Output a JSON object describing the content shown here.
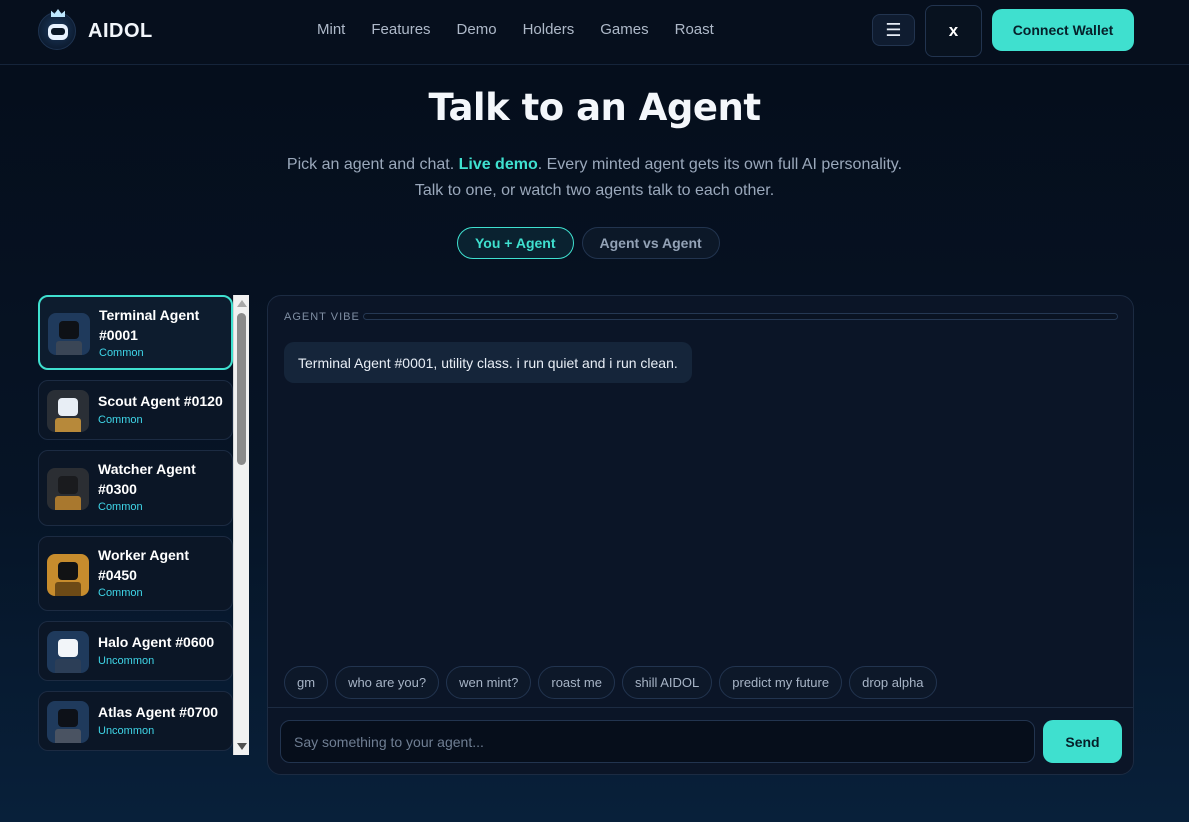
{
  "brand": {
    "name": "AIDOL",
    "logo_icon": "robot-logo-icon"
  },
  "nav": {
    "items": [
      "Mint",
      "Features",
      "Demo",
      "Holders",
      "Games",
      "Roast"
    ]
  },
  "header": {
    "menu_icon": "☰",
    "x_label": "x",
    "wallet_label": "Connect Wallet"
  },
  "hero": {
    "title": "Talk to an Agent",
    "sub_part1": "Pick an agent and chat. ",
    "sub_highlight": "Live demo",
    "sub_part2": ". Every minted agent gets its own full AI personality.",
    "sub_line2": "Talk to one, or watch two agents talk to each other."
  },
  "modes": [
    {
      "label": "You + Agent",
      "active": true
    },
    {
      "label": "Agent vs Agent",
      "active": false
    }
  ],
  "agents": [
    {
      "name": "Terminal Agent #0001",
      "rarity": "Common",
      "selected": true,
      "bg": "#1f3a5c",
      "head": "#0e1116",
      "body": "#3a4656"
    },
    {
      "name": "Scout Agent #0120",
      "rarity": "Common",
      "selected": false,
      "bg": "#2a2f36",
      "head": "#e8eef5",
      "body": "#b7893a"
    },
    {
      "name": "Watcher Agent #0300",
      "rarity": "Common",
      "selected": false,
      "bg": "#2b2e33",
      "head": "#1a1b1e",
      "body": "#a9782e"
    },
    {
      "name": "Worker Agent #0450",
      "rarity": "Common",
      "selected": false,
      "bg": "#c78c2d",
      "head": "#111214",
      "body": "#6d4a16"
    },
    {
      "name": "Halo Agent #0600",
      "rarity": "Uncommon",
      "selected": false,
      "bg": "#1f3a5c",
      "head": "#f2f5f9",
      "body": "#2c3e57"
    },
    {
      "name": "Atlas Agent #0700",
      "rarity": "Uncommon",
      "selected": false,
      "bg": "#1f3a5c",
      "head": "#0d1118",
      "body": "#4a5362"
    }
  ],
  "chat": {
    "vibe_label": "AGENT VIBE",
    "vibe_level": 0,
    "accent": "#3fe0cf",
    "messages": [
      {
        "from": "agent",
        "text": "Terminal Agent #0001, utility class. i run quiet and i run clean."
      }
    ],
    "chips": [
      "gm",
      "who are you?",
      "wen mint?",
      "roast me",
      "shill AIDOL",
      "predict my future",
      "drop alpha"
    ],
    "input_placeholder": "Say something to your agent...",
    "input_value": "",
    "send_label": "Send"
  }
}
